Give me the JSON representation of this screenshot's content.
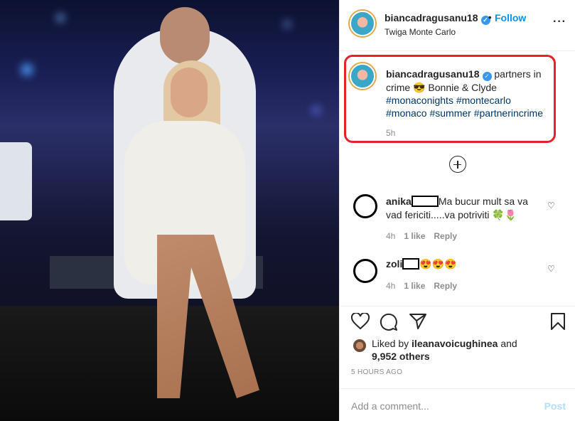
{
  "header": {
    "username": "biancadragusanu18",
    "follow_label": "Follow",
    "location": "Twiga Monte Carlo",
    "more_icon": "more-horizontal-icon"
  },
  "caption": {
    "username": "biancadragusanu18",
    "text": "partners in crime 😎 Bonnie & Clyde",
    "hashtags": [
      "#monaconights",
      "#montecarlo",
      "#monaco",
      "#summer",
      "#partnerincrime"
    ],
    "time": "5h",
    "highlight_color": "#e3222b"
  },
  "load_more_icon": "plus-circle-icon",
  "comments": [
    {
      "username": "anika",
      "text": "Ma bucur mult sa va vad fericiti.....va potriviti 🍀🌷",
      "time": "4h",
      "likes": "1 like",
      "reply": "Reply"
    },
    {
      "username": "zoli",
      "text": "😍😍😍",
      "time": "4h",
      "likes": "1 like",
      "reply": "Reply"
    }
  ],
  "actions": {
    "like_icon": "heart-icon",
    "comment_icon": "comment-icon",
    "share_icon": "paper-plane-icon",
    "save_icon": "bookmark-icon"
  },
  "likes": {
    "prefix": "Liked by",
    "user": "ileanavoicughinea",
    "and": "and",
    "others": "9,952 others"
  },
  "timestamp": "5 HOURS AGO",
  "add_comment": {
    "placeholder": "Add a comment...",
    "post_label": "Post"
  },
  "colors": {
    "accent": "#0095f6",
    "hashtag": "#00376b",
    "muted": "#8e8e8e"
  }
}
